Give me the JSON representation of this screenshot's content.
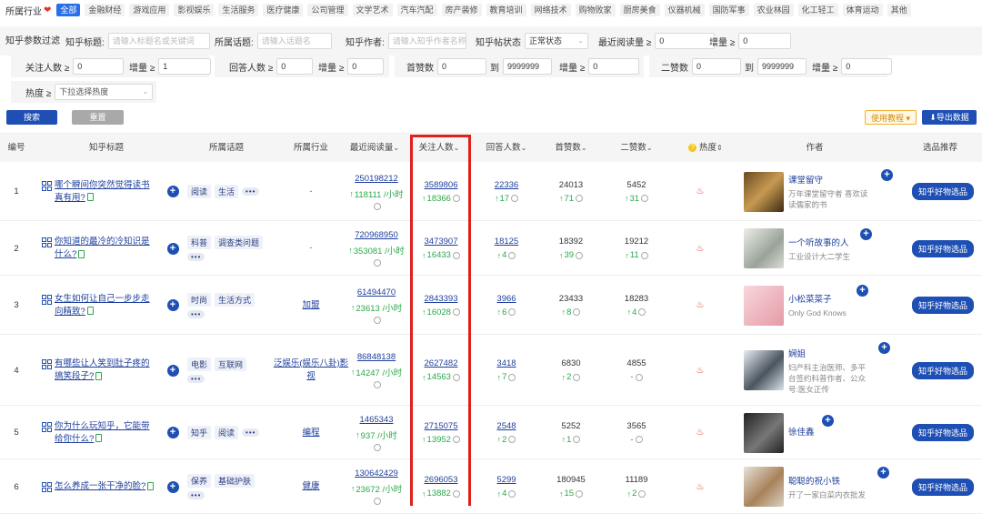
{
  "category_bar": {
    "label": "所属行业",
    "tags": [
      "全部",
      "金融财经",
      "游戏应用",
      "影视娱乐",
      "生活服务",
      "医疗健康",
      "公司管理",
      "文学艺术",
      "汽车汽配",
      "房产装修",
      "教育培训",
      "网络技术",
      "购物败家",
      "厨房美食",
      "仪器机械",
      "国防军事",
      "农业林园",
      "化工轻工",
      "体育运动",
      "其他"
    ],
    "active_index": 0
  },
  "filters": {
    "section_label": "知乎参数过滤",
    "title_label": "知乎标题:",
    "title_placeholder": "请输入标题名或关键词",
    "topic_label": "所属话题:",
    "topic_placeholder": "请输入话题名",
    "author_label": "知乎作者:",
    "author_placeholder": "请输入知乎作者名称",
    "status_label": "知乎帖状态",
    "status_value": "正常状态",
    "recent_reads_label": "最近阅读量 ≥",
    "recent_reads_value": "0",
    "increase_label": "增量 ≥",
    "increase_value": "0",
    "followers_label": "关注人数 ≥",
    "followers_value": "0",
    "followers_increase_value": "1",
    "answers_label": "回答人数 ≥",
    "answers_value": "0",
    "answers_increase_value": "0",
    "first_likes_label": "首赞数",
    "first_likes_min": "0",
    "to_label": "到",
    "first_likes_max": "9999999",
    "first_likes_increase_value": "0",
    "second_likes_label": "二赞数",
    "second_likes_min": "0",
    "second_likes_max": "9999999",
    "second_likes_increase_value": "0",
    "heat_label": "热度 ≥",
    "heat_value": "下拉选择热度"
  },
  "actions": {
    "search": "搜索",
    "reset": "重置",
    "guide": "使用教程",
    "export": "导出数据"
  },
  "table": {
    "headers": {
      "index": "编号",
      "title": "知乎标题",
      "topic": "所属话题",
      "industry": "所属行业",
      "recent_reads": "最近阅读量",
      "followers": "关注人数",
      "answers": "回答人数",
      "first_likes": "首赞数",
      "second_likes": "二赞数",
      "heat": "热度",
      "author": "作者",
      "pick": "选品推荐"
    },
    "rows": [
      {
        "index": "1",
        "title": "哪个瞬间你突然觉得读书真有用?",
        "topics": [
          "阅读",
          "生活"
        ],
        "industry": "-",
        "reads": "250198212",
        "reads_delta": "118111 /小时",
        "followers": "3589806",
        "followers_delta": "18366",
        "answers": "22336",
        "answers_delta": "17",
        "first_likes": "24013",
        "first_delta": "71",
        "second_likes": "5452",
        "second_delta": "31",
        "author_name": "课堂留守",
        "author_desc": "万年课堂留守者 喜欢读读儒家的书",
        "pick": "知乎好物选品"
      },
      {
        "index": "2",
        "title": "你知道的最冷的冷知识是什么?",
        "topics": [
          "科普",
          "调查类问题"
        ],
        "industry": "-",
        "reads": "720968950",
        "reads_delta": "353081 /小时",
        "followers": "3473907",
        "followers_delta": "16433",
        "answers": "18125",
        "answers_delta": "4",
        "first_likes": "18392",
        "first_delta": "39",
        "second_likes": "19212",
        "second_delta": "11",
        "author_name": "一个听故事的人",
        "author_desc": "工业设计大二学生",
        "pick": "知乎好物选品"
      },
      {
        "index": "3",
        "title": "女生如何让自己一步步走向精致?",
        "topics": [
          "时尚",
          "生活方式"
        ],
        "industry": "加盟",
        "reads": "61494470",
        "reads_delta": "23613 /小时",
        "followers": "2843393",
        "followers_delta": "16028",
        "answers": "3966",
        "answers_delta": "6",
        "first_likes": "23433",
        "first_delta": "8",
        "second_likes": "18283",
        "second_delta": "4",
        "author_name": "小松菜菜子",
        "author_desc": "Only God Knows",
        "pick": "知乎好物选品"
      },
      {
        "index": "4",
        "title": "有哪些让人笑到肚子疼的搞笑段子?",
        "topics": [
          "电影",
          "互联网"
        ],
        "industry": "泛娱乐(娱乐八卦)影视",
        "reads": "86848138",
        "reads_delta": "14247 /小时",
        "followers": "2627482",
        "followers_delta": "14563",
        "answers": "3418",
        "answers_delta": "7",
        "first_likes": "6830",
        "first_delta": "2",
        "second_likes": "4855",
        "second_delta": "-",
        "author_name": "娴姐",
        "author_desc": "妇产科主治医师、多平台签约科普作者、公众号:医女正传",
        "pick": "知乎好物选品"
      },
      {
        "index": "5",
        "title": "你为什么玩知乎，它能带给你什么?",
        "topics": [
          "知乎",
          "阅读"
        ],
        "industry": "编程",
        "reads": "1465343",
        "reads_delta": "937 /小时",
        "followers": "2715075",
        "followers_delta": "13952",
        "answers": "2548",
        "answers_delta": "2",
        "first_likes": "5252",
        "first_delta": "1",
        "second_likes": "3565",
        "second_delta": "-",
        "author_name": "徐佳鑫",
        "author_desc": "",
        "pick": "知乎好物选品"
      },
      {
        "index": "6",
        "title": "怎么养成一张干净的脸?",
        "topics": [
          "保养",
          "基础护肤"
        ],
        "industry": "健康",
        "reads": "130642429",
        "reads_delta": "23672 /小时",
        "followers": "2696053",
        "followers_delta": "13882",
        "answers": "5299",
        "answers_delta": "4",
        "first_likes": "180945",
        "first_delta": "15",
        "second_likes": "11189",
        "second_delta": "2",
        "author_name": "聪聪的祝小铁",
        "author_desc": "开了一家白菜内衣批发",
        "pick": "知乎好物选品"
      }
    ]
  },
  "colors": {
    "primary": "#1e4fb4",
    "highlight_box": "#e0201c",
    "increase": "#2aa84a"
  }
}
